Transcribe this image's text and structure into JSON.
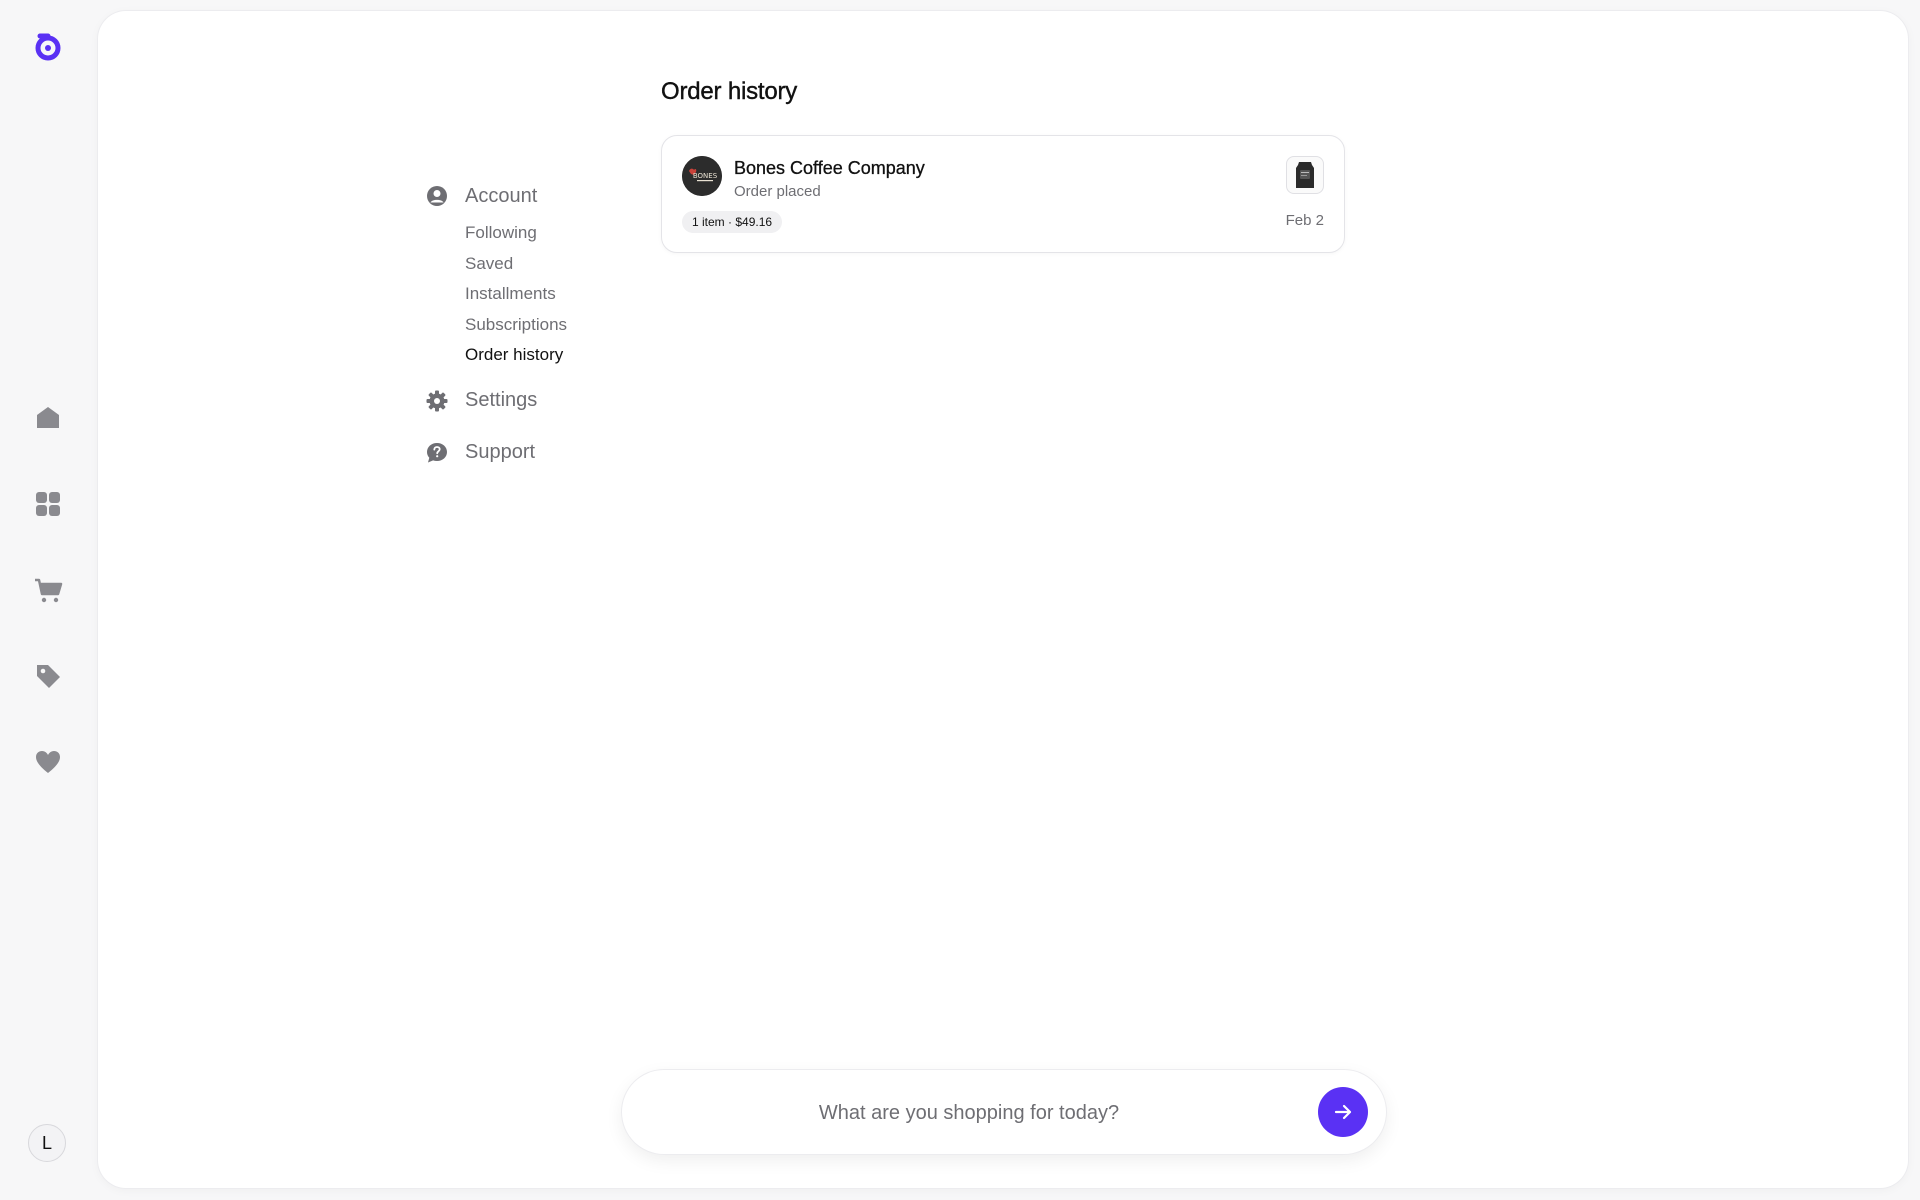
{
  "rail": {
    "avatar_letter": "L",
    "icons": [
      "home-icon",
      "grid-icon",
      "cart-icon",
      "tag-icon",
      "heart-icon"
    ]
  },
  "subnav": {
    "account_label": "Account",
    "account_items": [
      {
        "label": "Following"
      },
      {
        "label": "Saved"
      },
      {
        "label": "Installments"
      },
      {
        "label": "Subscriptions"
      },
      {
        "label": "Order history",
        "active": true
      }
    ],
    "settings_label": "Settings",
    "support_label": "Support"
  },
  "main": {
    "title": "Order history",
    "orders": [
      {
        "merchant": "Bones Coffee Company",
        "status": "Order placed",
        "summary": "1 item · $49.16",
        "date": "Feb 2",
        "logo_text": "BONES"
      }
    ]
  },
  "search": {
    "placeholder": "What are you shopping for today?"
  },
  "colors": {
    "accent": "#5a31f4",
    "text_primary": "#111111",
    "text_secondary": "#6e6e73",
    "background": "#f7f7f8"
  }
}
